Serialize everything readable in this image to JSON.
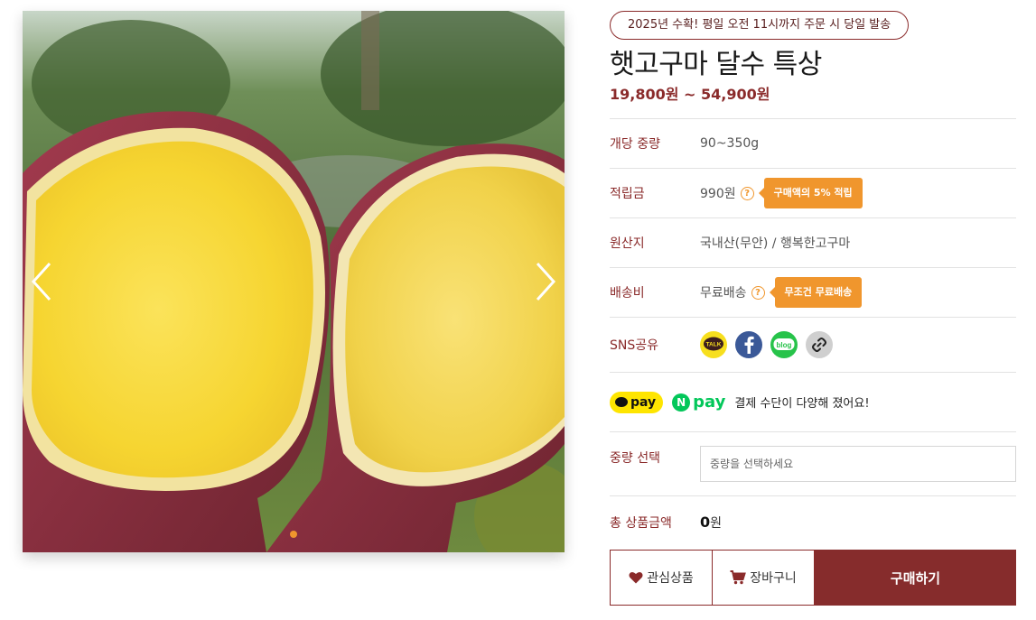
{
  "gallery": {
    "image_alt": "햇고구마 달수 특상",
    "active_slide": 1,
    "slide_count": 1
  },
  "product": {
    "harvest_badge": "2025년 수확! 평일 오전 11시까지 주문 시 당일 발송",
    "title": "햇고구마 달수 특상",
    "price": "19,800원 ~ 54,900원"
  },
  "specs": {
    "weight_label": "개당 중량",
    "weight_value": "90~350g",
    "points_label": "적립금",
    "points_value": "990원",
    "points_tooltip": "구매액의 5% 적립",
    "origin_label": "원산지",
    "origin_value": "국내산(무안) / 행복한고구마",
    "shipping_label": "배송비",
    "shipping_value": "무료배송",
    "shipping_tooltip": "무조건 무료배송",
    "sns_label": "SNS공유"
  },
  "sns_icons": {
    "kakao": "TALK",
    "blog": "blog"
  },
  "payment": {
    "kakaopay": "pay",
    "npay_n": "N",
    "npay": "pay",
    "text": "결제 수단이 다양해 졌어요!"
  },
  "option": {
    "label": "중량 선택",
    "placeholder": "중량을 선택하세요"
  },
  "total": {
    "label": "총 상품금액",
    "amount": "0",
    "unit": "원"
  },
  "buttons": {
    "wishlist": "관심상품",
    "cart": "장바구니",
    "buy": "구매하기"
  },
  "colors": {
    "brand": "#8a2a2a",
    "buy_button": "#862c2c",
    "accent_orange": "#f0962d",
    "kakao_yellow": "#fee500",
    "naver_green": "#03c75a"
  }
}
